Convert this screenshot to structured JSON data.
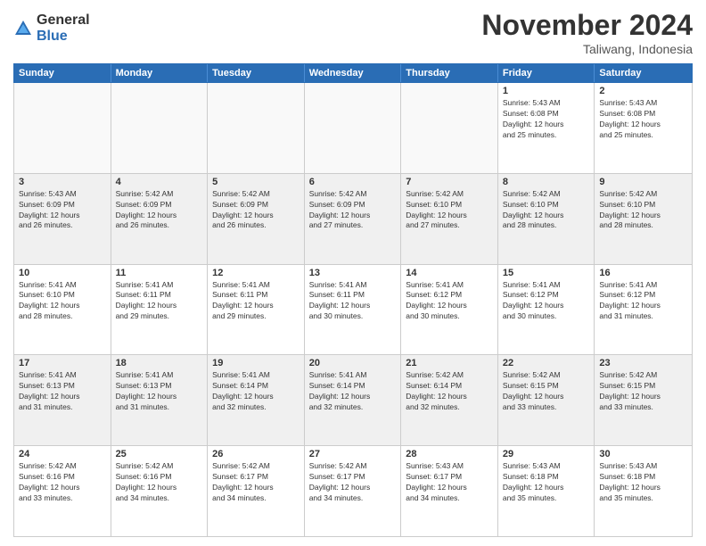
{
  "logo": {
    "general": "General",
    "blue": "Blue"
  },
  "title": "November 2024",
  "subtitle": "Taliwang, Indonesia",
  "header_days": [
    "Sunday",
    "Monday",
    "Tuesday",
    "Wednesday",
    "Thursday",
    "Friday",
    "Saturday"
  ],
  "weeks": [
    [
      {
        "day": "",
        "info": ""
      },
      {
        "day": "",
        "info": ""
      },
      {
        "day": "",
        "info": ""
      },
      {
        "day": "",
        "info": ""
      },
      {
        "day": "",
        "info": ""
      },
      {
        "day": "1",
        "info": "Sunrise: 5:43 AM\nSunset: 6:08 PM\nDaylight: 12 hours\nand 25 minutes."
      },
      {
        "day": "2",
        "info": "Sunrise: 5:43 AM\nSunset: 6:08 PM\nDaylight: 12 hours\nand 25 minutes."
      }
    ],
    [
      {
        "day": "3",
        "info": "Sunrise: 5:43 AM\nSunset: 6:09 PM\nDaylight: 12 hours\nand 26 minutes."
      },
      {
        "day": "4",
        "info": "Sunrise: 5:42 AM\nSunset: 6:09 PM\nDaylight: 12 hours\nand 26 minutes."
      },
      {
        "day": "5",
        "info": "Sunrise: 5:42 AM\nSunset: 6:09 PM\nDaylight: 12 hours\nand 26 minutes."
      },
      {
        "day": "6",
        "info": "Sunrise: 5:42 AM\nSunset: 6:09 PM\nDaylight: 12 hours\nand 27 minutes."
      },
      {
        "day": "7",
        "info": "Sunrise: 5:42 AM\nSunset: 6:10 PM\nDaylight: 12 hours\nand 27 minutes."
      },
      {
        "day": "8",
        "info": "Sunrise: 5:42 AM\nSunset: 6:10 PM\nDaylight: 12 hours\nand 28 minutes."
      },
      {
        "day": "9",
        "info": "Sunrise: 5:42 AM\nSunset: 6:10 PM\nDaylight: 12 hours\nand 28 minutes."
      }
    ],
    [
      {
        "day": "10",
        "info": "Sunrise: 5:41 AM\nSunset: 6:10 PM\nDaylight: 12 hours\nand 28 minutes."
      },
      {
        "day": "11",
        "info": "Sunrise: 5:41 AM\nSunset: 6:11 PM\nDaylight: 12 hours\nand 29 minutes."
      },
      {
        "day": "12",
        "info": "Sunrise: 5:41 AM\nSunset: 6:11 PM\nDaylight: 12 hours\nand 29 minutes."
      },
      {
        "day": "13",
        "info": "Sunrise: 5:41 AM\nSunset: 6:11 PM\nDaylight: 12 hours\nand 30 minutes."
      },
      {
        "day": "14",
        "info": "Sunrise: 5:41 AM\nSunset: 6:12 PM\nDaylight: 12 hours\nand 30 minutes."
      },
      {
        "day": "15",
        "info": "Sunrise: 5:41 AM\nSunset: 6:12 PM\nDaylight: 12 hours\nand 30 minutes."
      },
      {
        "day": "16",
        "info": "Sunrise: 5:41 AM\nSunset: 6:12 PM\nDaylight: 12 hours\nand 31 minutes."
      }
    ],
    [
      {
        "day": "17",
        "info": "Sunrise: 5:41 AM\nSunset: 6:13 PM\nDaylight: 12 hours\nand 31 minutes."
      },
      {
        "day": "18",
        "info": "Sunrise: 5:41 AM\nSunset: 6:13 PM\nDaylight: 12 hours\nand 31 minutes."
      },
      {
        "day": "19",
        "info": "Sunrise: 5:41 AM\nSunset: 6:14 PM\nDaylight: 12 hours\nand 32 minutes."
      },
      {
        "day": "20",
        "info": "Sunrise: 5:41 AM\nSunset: 6:14 PM\nDaylight: 12 hours\nand 32 minutes."
      },
      {
        "day": "21",
        "info": "Sunrise: 5:42 AM\nSunset: 6:14 PM\nDaylight: 12 hours\nand 32 minutes."
      },
      {
        "day": "22",
        "info": "Sunrise: 5:42 AM\nSunset: 6:15 PM\nDaylight: 12 hours\nand 33 minutes."
      },
      {
        "day": "23",
        "info": "Sunrise: 5:42 AM\nSunset: 6:15 PM\nDaylight: 12 hours\nand 33 minutes."
      }
    ],
    [
      {
        "day": "24",
        "info": "Sunrise: 5:42 AM\nSunset: 6:16 PM\nDaylight: 12 hours\nand 33 minutes."
      },
      {
        "day": "25",
        "info": "Sunrise: 5:42 AM\nSunset: 6:16 PM\nDaylight: 12 hours\nand 34 minutes."
      },
      {
        "day": "26",
        "info": "Sunrise: 5:42 AM\nSunset: 6:17 PM\nDaylight: 12 hours\nand 34 minutes."
      },
      {
        "day": "27",
        "info": "Sunrise: 5:42 AM\nSunset: 6:17 PM\nDaylight: 12 hours\nand 34 minutes."
      },
      {
        "day": "28",
        "info": "Sunrise: 5:43 AM\nSunset: 6:17 PM\nDaylight: 12 hours\nand 34 minutes."
      },
      {
        "day": "29",
        "info": "Sunrise: 5:43 AM\nSunset: 6:18 PM\nDaylight: 12 hours\nand 35 minutes."
      },
      {
        "day": "30",
        "info": "Sunrise: 5:43 AM\nSunset: 6:18 PM\nDaylight: 12 hours\nand 35 minutes."
      }
    ]
  ]
}
